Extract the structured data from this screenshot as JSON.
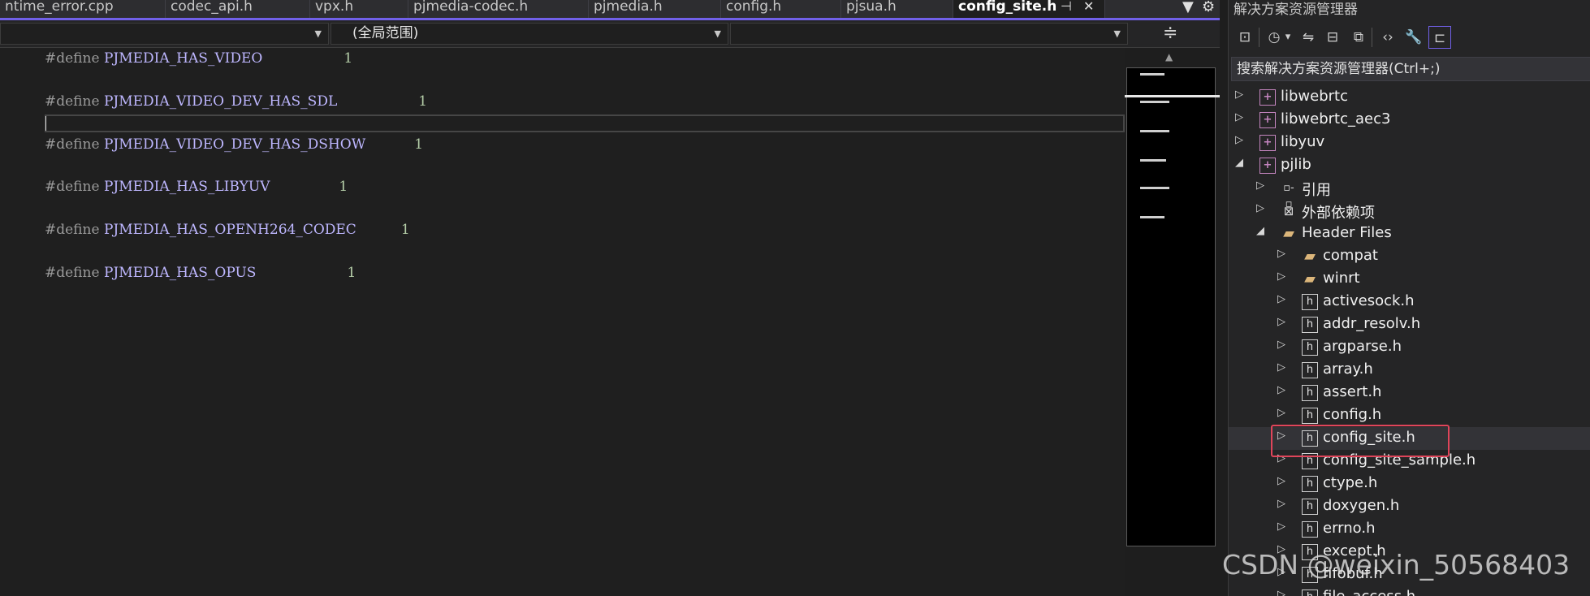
{
  "tabs": [
    {
      "label": "ntime_error.cpp"
    },
    {
      "label": "codec_api.h"
    },
    {
      "label": "vpx.h"
    },
    {
      "label": "pjmedia-codec.h"
    },
    {
      "label": "pjmedia.h"
    },
    {
      "label": "config.h"
    },
    {
      "label": "pjsua.h"
    },
    {
      "label": "config_site.h",
      "active": true
    }
  ],
  "tab_pin_glyph": "⊣",
  "tab_close_glyph": "✕",
  "nav": {
    "scope": "(全局范围)"
  },
  "code": {
    "lines": [
      {
        "keyword": "#define",
        "macro": "PJMEDIA_HAS_VIDEO",
        "value": "1"
      },
      {
        "keyword": "#define",
        "macro": "PJMEDIA_VIDEO_DEV_HAS_SDL",
        "value": "1"
      },
      {
        "keyword": "#define",
        "macro": "PJMEDIA_VIDEO_DEV_HAS_DSHOW",
        "value": "1"
      },
      {
        "keyword": "#define",
        "macro": "PJMEDIA_HAS_LIBYUV",
        "value": "1"
      },
      {
        "keyword": "#define",
        "macro": "PJMEDIA_HAS_OPENH264_CODEC",
        "value": "1"
      },
      {
        "keyword": "#define",
        "macro": "PJMEDIA_HAS_OPUS",
        "value": "1"
      }
    ]
  },
  "explorer": {
    "title": "解决方案资源管理器",
    "search_placeholder": "搜索解决方案资源管理器(Ctrl+;)",
    "toolbar_icons": [
      "vs-solution-icon",
      "history-icon",
      "dropdown-arrow-icon",
      "sync-icon",
      "collapse-all-icon",
      "copy-icon",
      "code-view-icon",
      "properties-wrench-icon",
      "preview-icon"
    ],
    "tree": [
      {
        "label": "libwebrtc",
        "icon": "project",
        "level": 0,
        "expanded": false
      },
      {
        "label": "libwebrtc_aec3",
        "icon": "project",
        "level": 0,
        "expanded": false
      },
      {
        "label": "libyuv",
        "icon": "project",
        "level": 0,
        "expanded": false
      },
      {
        "label": "pjlib",
        "icon": "project",
        "level": 0,
        "expanded": true
      },
      {
        "label": "引用",
        "icon": "references",
        "level": 1,
        "expanded": false
      },
      {
        "label": "外部依赖项",
        "icon": "external",
        "level": 1,
        "expanded": false
      },
      {
        "label": "Header Files",
        "icon": "folder",
        "level": 1,
        "expanded": true
      },
      {
        "label": "compat",
        "icon": "folder",
        "level": 2,
        "expanded": false
      },
      {
        "label": "winrt",
        "icon": "folder",
        "level": 2,
        "expanded": false
      },
      {
        "label": "activesock.h",
        "icon": "header",
        "level": 2,
        "expanded": false
      },
      {
        "label": "addr_resolv.h",
        "icon": "header",
        "level": 2,
        "expanded": false
      },
      {
        "label": "argparse.h",
        "icon": "header",
        "level": 2,
        "expanded": false
      },
      {
        "label": "array.h",
        "icon": "header",
        "level": 2,
        "expanded": false
      },
      {
        "label": "assert.h",
        "icon": "header",
        "level": 2,
        "expanded": false
      },
      {
        "label": "config.h",
        "icon": "header",
        "level": 2,
        "expanded": false
      },
      {
        "label": "config_site.h",
        "icon": "header",
        "level": 2,
        "expanded": false,
        "selected": true
      },
      {
        "label": "config_site_sample.h",
        "icon": "header",
        "level": 2,
        "expanded": false
      },
      {
        "label": "ctype.h",
        "icon": "header",
        "level": 2,
        "expanded": false
      },
      {
        "label": "doxygen.h",
        "icon": "header",
        "level": 2,
        "expanded": false
      },
      {
        "label": "errno.h",
        "icon": "header",
        "level": 2,
        "expanded": false
      },
      {
        "label": "except.h",
        "icon": "header",
        "level": 2,
        "expanded": false
      },
      {
        "label": "fifobuf.h",
        "icon": "header",
        "level": 2,
        "expanded": false
      },
      {
        "label": "file_access.h",
        "icon": "header",
        "level": 2,
        "expanded": false
      }
    ]
  },
  "watermark": "CSDN @weixin_50568403",
  "colors": {
    "accent": "#7160e8",
    "macro": "#beb7ff",
    "keyword": "#9b9b9b",
    "number": "#b5cea8",
    "highlight": "#e0455a"
  }
}
